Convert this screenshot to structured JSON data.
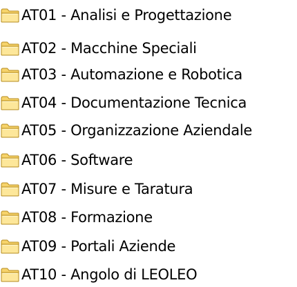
{
  "folders": [
    {
      "label": "AT01 - Analisi e Progettazione",
      "icon": "folder-icon"
    },
    {
      "label": "AT02 - Macchine Speciali",
      "icon": "folder-icon"
    },
    {
      "label": "AT03 - Automazione e Robotica",
      "icon": "folder-icon"
    },
    {
      "label": "AT04 - Documentazione Tecnica",
      "icon": "folder-icon"
    },
    {
      "label": "AT05 - Organizzazione Aziendale",
      "icon": "folder-icon"
    },
    {
      "label": "AT06 - Software",
      "icon": "folder-icon"
    },
    {
      "label": "AT07 - Misure e Taratura",
      "icon": "folder-icon"
    },
    {
      "label": "AT08 - Formazione",
      "icon": "folder-icon"
    },
    {
      "label": "AT09 - Portali Aziende",
      "icon": "folder-icon"
    },
    {
      "label": "AT10 - Angolo di LEOLEO",
      "icon": "folder-icon"
    }
  ],
  "colors": {
    "folder_body": "#f6d36b",
    "folder_front": "#fde79a",
    "folder_outline": "#b58b1e",
    "text": "#000000",
    "background": "#ffffff"
  }
}
